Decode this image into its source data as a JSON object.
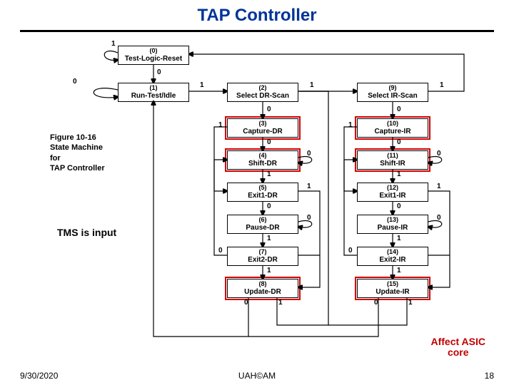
{
  "title": "TAP Controller",
  "footer": {
    "date": "9/30/2020",
    "center": "UAH©AM",
    "page": "18"
  },
  "figcaption": {
    "l1": "Figure 10-16",
    "l2": "State Machine",
    "l3": "for",
    "l4": "TAP Controller"
  },
  "notes": {
    "tms": "TMS is input",
    "affect1": "Affect ASIC",
    "affect2": "core"
  },
  "states": {
    "s0": {
      "num": "(0)",
      "name": "Test-Logic-Reset"
    },
    "s1": {
      "num": "(1)",
      "name": "Run-Test/Idle"
    },
    "s2": {
      "num": "(2)",
      "name": "Select DR-Scan"
    },
    "s3": {
      "num": "(3)",
      "name": "Capture-DR"
    },
    "s4": {
      "num": "(4)",
      "name": "Shift-DR"
    },
    "s5": {
      "num": "(5)",
      "name": "Exit1-DR"
    },
    "s6": {
      "num": "(6)",
      "name": "Pause-DR"
    },
    "s7": {
      "num": "(7)",
      "name": "Exit2-DR"
    },
    "s8": {
      "num": "(8)",
      "name": "Update-DR"
    },
    "s9": {
      "num": "(9)",
      "name": "Select IR-Scan"
    },
    "s10": {
      "num": "(10)",
      "name": "Capture-IR"
    },
    "s11": {
      "num": "(11)",
      "name": "Shift-IR"
    },
    "s12": {
      "num": "(12)",
      "name": "Exit1-IR"
    },
    "s13": {
      "num": "(13)",
      "name": "Pause-IR"
    },
    "s14": {
      "num": "(14)",
      "name": "Exit2-IR"
    },
    "s15": {
      "num": "(15)",
      "name": "Update-IR"
    }
  },
  "edges": {
    "e0_loop": "1",
    "e0_1": "0",
    "e1_loop": "0",
    "e1_2": "1",
    "e2_3": "0",
    "e2_9": "1",
    "e9_10": "0",
    "e9_0": "1",
    "e3_4": "0",
    "e3_5": "1",
    "e4_loop": "0",
    "e4_5": "1",
    "e5_6": "0",
    "e5_8": "1",
    "e6_loop": "0",
    "e6_7": "1",
    "e7_4": "0",
    "e7_8": "1",
    "e8_1": "0",
    "e8_2": "1",
    "e10_11": "0",
    "e10_12": "1",
    "e11_loop": "0",
    "e11_12": "1",
    "e12_13": "0",
    "e12_15": "1",
    "e13_loop": "0",
    "e13_14": "1",
    "e14_11": "0",
    "e14_15": "1",
    "e15_1": "0",
    "e15_2": "1"
  }
}
